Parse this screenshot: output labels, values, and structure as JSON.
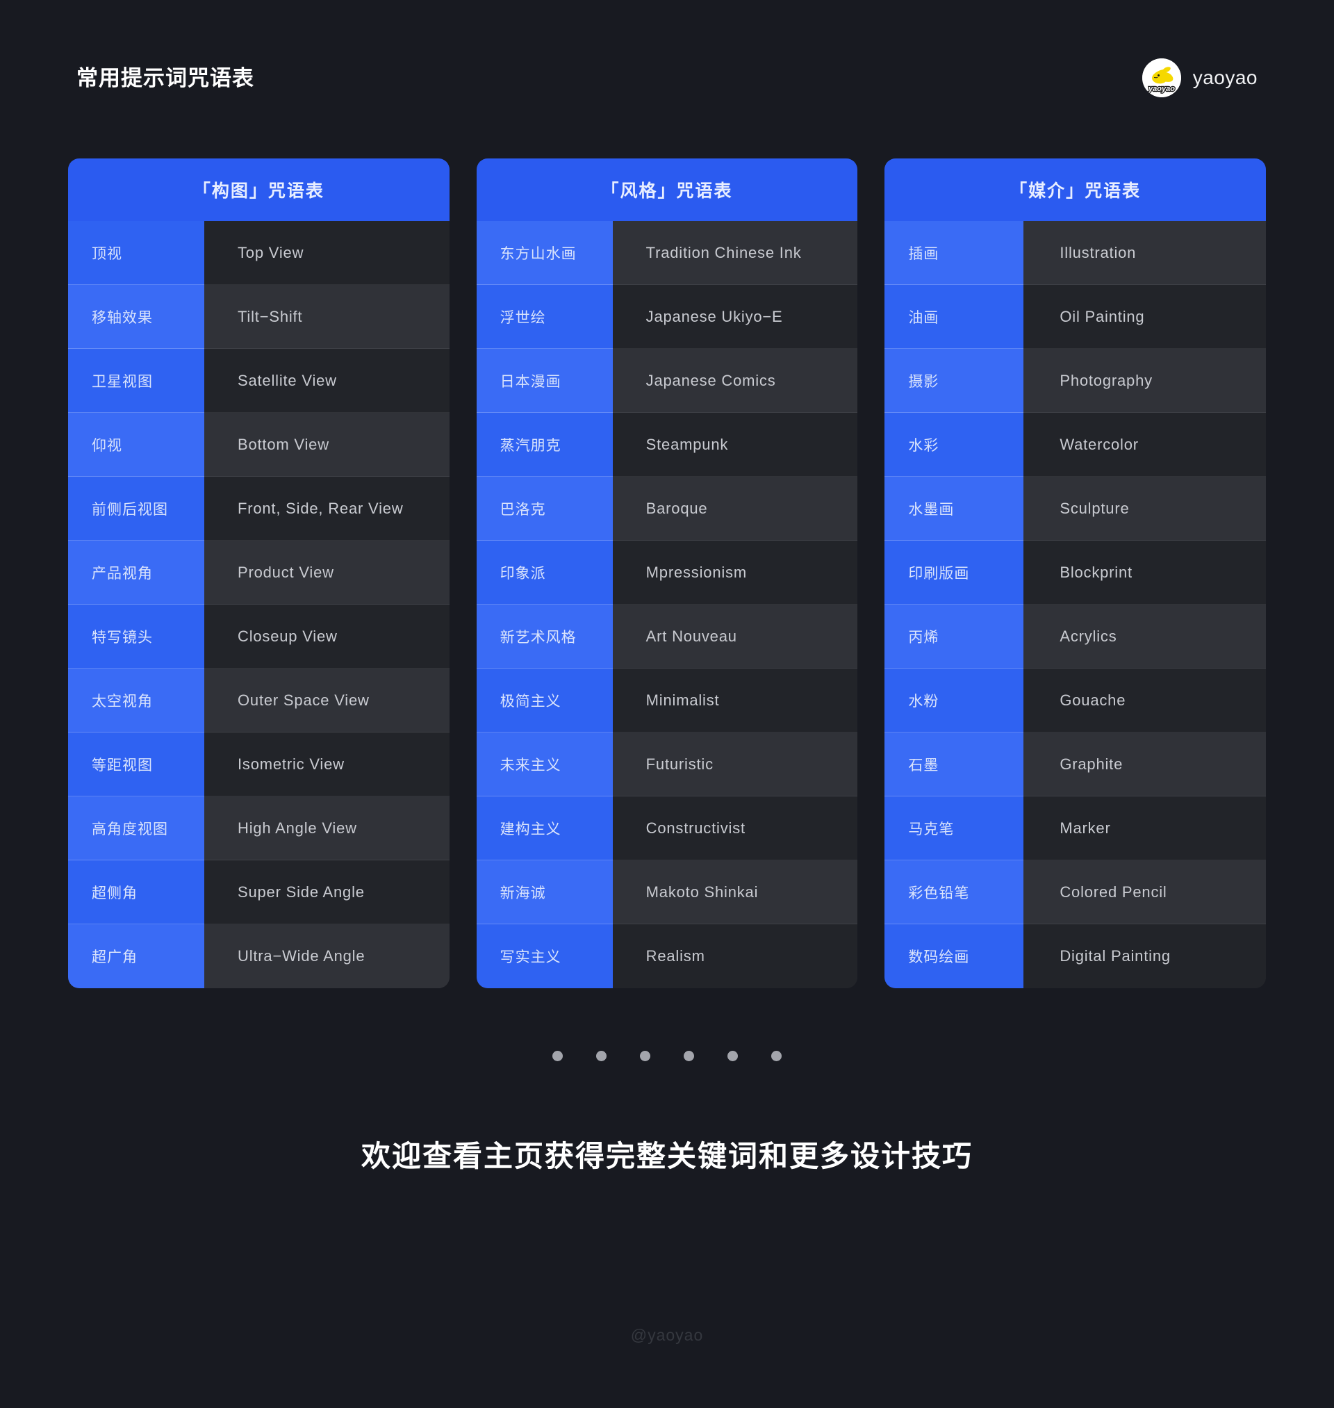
{
  "header": {
    "title": "常用提示词咒语表",
    "brand_name": "yaoyao",
    "logo_icon": "rabbit-logo-icon",
    "logo_wordmark": "yaoyao"
  },
  "cards": [
    {
      "id": "composition",
      "title": "「构图」咒语表",
      "rows": [
        {
          "cn": "顶视",
          "en": "Top View"
        },
        {
          "cn": "移轴效果",
          "en": "Tilt−Shift"
        },
        {
          "cn": "卫星视图",
          "en": "Satellite View"
        },
        {
          "cn": "仰视",
          "en": "Bottom View"
        },
        {
          "cn": "前侧后视图",
          "en": "Front, Side, Rear View"
        },
        {
          "cn": "产品视角",
          "en": "Product View"
        },
        {
          "cn": "特写镜头",
          "en": "Closeup View"
        },
        {
          "cn": "太空视角",
          "en": "Outer Space View"
        },
        {
          "cn": "等距视图",
          "en": "Isometric View"
        },
        {
          "cn": "高角度视图",
          "en": "High Angle View"
        },
        {
          "cn": "超侧角",
          "en": "Super Side Angle"
        },
        {
          "cn": "超广角",
          "en": "Ultra−Wide Angle"
        }
      ]
    },
    {
      "id": "style",
      "title": "「风格」咒语表",
      "rows": [
        {
          "cn": "东方山水画",
          "en": "Tradition Chinese Ink"
        },
        {
          "cn": "浮世绘",
          "en": "Japanese Ukiyo−E"
        },
        {
          "cn": "日本漫画",
          "en": "Japanese Comics"
        },
        {
          "cn": "蒸汽朋克",
          "en": "Steampunk"
        },
        {
          "cn": "巴洛克",
          "en": "Baroque"
        },
        {
          "cn": "印象派",
          "en": "Mpressionism"
        },
        {
          "cn": "新艺术风格",
          "en": "Art Nouveau"
        },
        {
          "cn": "极简主义",
          "en": "Minimalist"
        },
        {
          "cn": "未来主义",
          "en": "Futuristic"
        },
        {
          "cn": "建构主义",
          "en": "Constructivist"
        },
        {
          "cn": "新海诚",
          "en": "Makoto Shinkai"
        },
        {
          "cn": "写实主义",
          "en": "Realism"
        }
      ]
    },
    {
      "id": "medium",
      "title": "「媒介」咒语表",
      "rows": [
        {
          "cn": "插画",
          "en": "Illustration"
        },
        {
          "cn": "油画",
          "en": "Oil Painting"
        },
        {
          "cn": "摄影",
          "en": "Photography"
        },
        {
          "cn": "水彩",
          "en": "Watercolor"
        },
        {
          "cn": "水墨画",
          "en": "Sculpture"
        },
        {
          "cn": "印刷版画",
          "en": "Blockprint"
        },
        {
          "cn": "丙烯",
          "en": "Acrylics"
        },
        {
          "cn": "水粉",
          "en": "Gouache"
        },
        {
          "cn": "石墨",
          "en": "Graphite"
        },
        {
          "cn": "马克笔",
          "en": "Marker"
        },
        {
          "cn": "彩色铅笔",
          "en": "Colored Pencil"
        },
        {
          "cn": "数码绘画",
          "en": "Digital Painting"
        }
      ]
    }
  ],
  "pagination": {
    "total_dots": 6
  },
  "footer": {
    "cta": "欢迎查看主页获得完整关键词和更多设计技巧",
    "watermark": "@yaoyao"
  },
  "colors": {
    "background": "#181A21",
    "card_header_blue": "#2B5BF0",
    "cell_blue": "#2F62F2",
    "cell_blue_alt": "#3A6BF5",
    "cell_dark": "#222429",
    "cell_dark_alt": "#303238",
    "logo_yellow": "#F5D800",
    "dot_gray": "#A3A5AC",
    "watermark_gray": "#35383F"
  }
}
